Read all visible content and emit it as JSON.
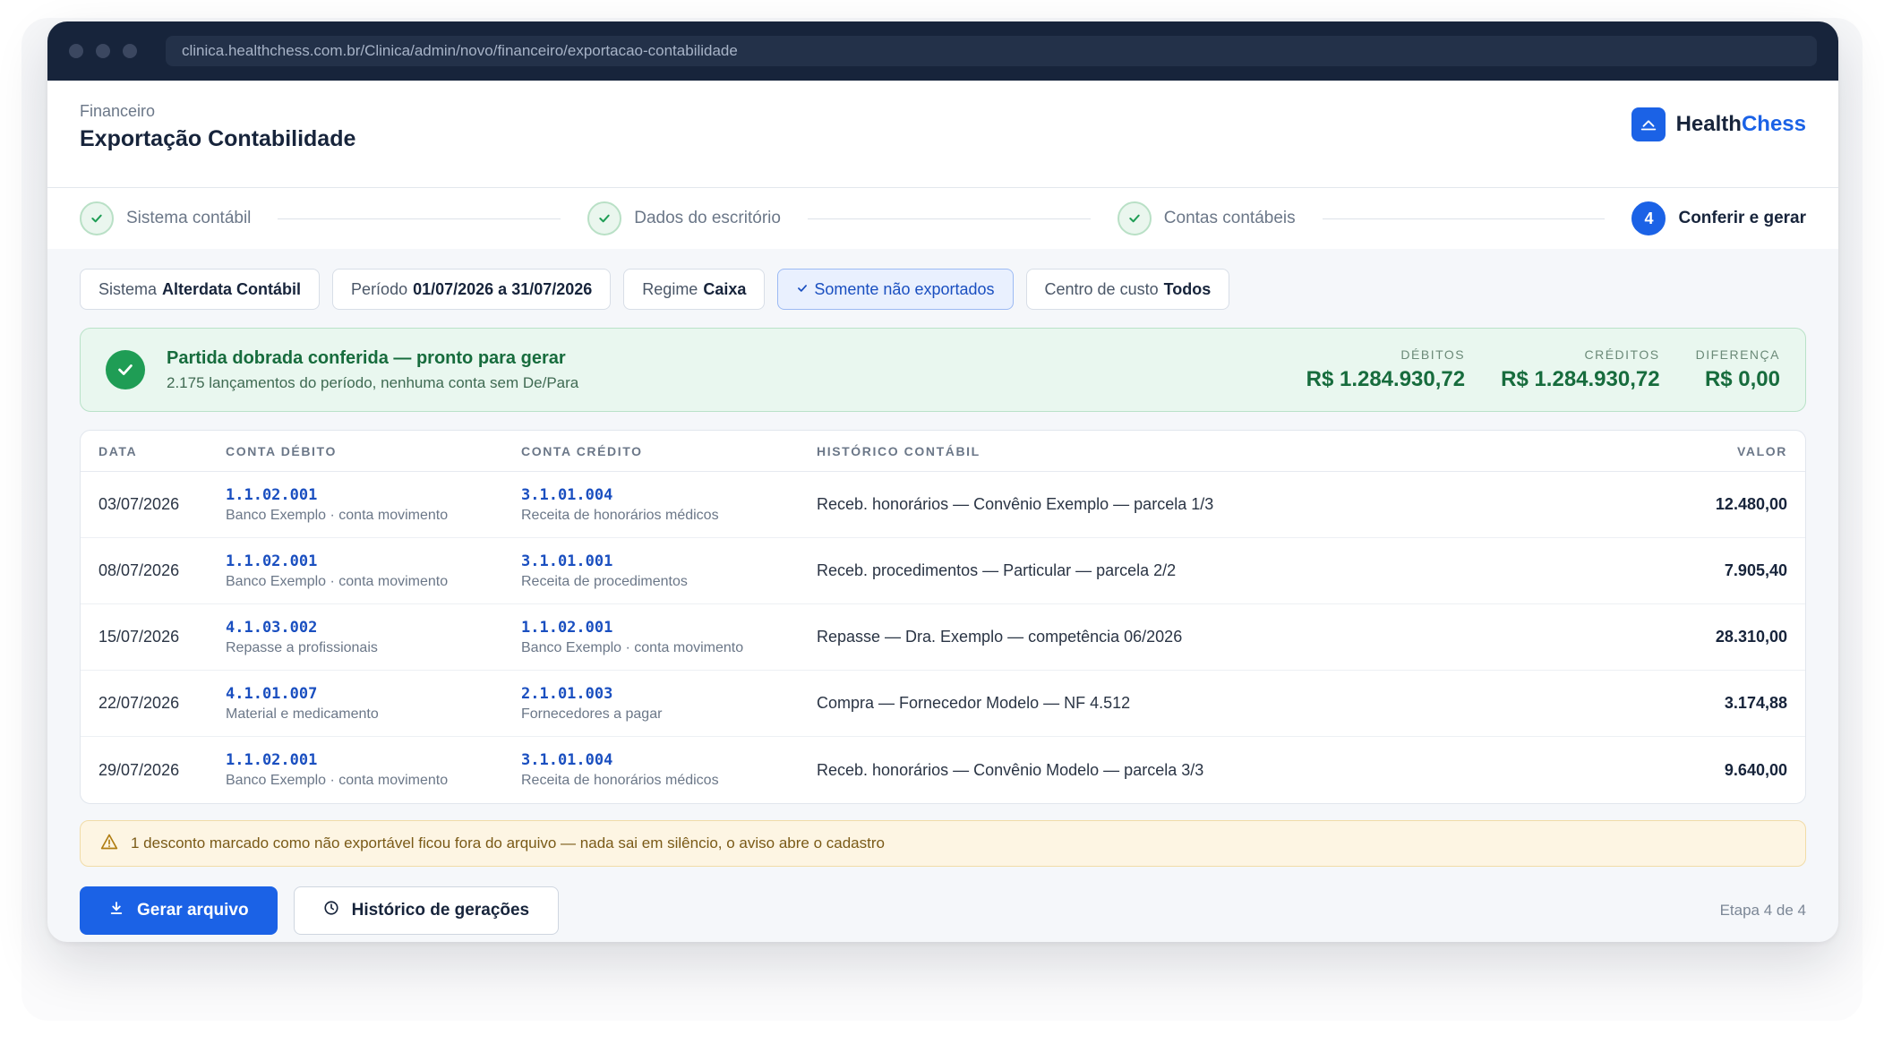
{
  "browser": {
    "url": "clinica.healthchess.com.br/Clinica/admin/novo/financeiro/exportacao-contabilidade"
  },
  "header": {
    "breadcrumb": "Financeiro",
    "title": "Exportação Contabilidade",
    "brand_primary": "Health",
    "brand_accent": "Chess"
  },
  "stepper": {
    "steps": [
      {
        "label": "Sistema contábil",
        "status": "done"
      },
      {
        "label": "Dados do escritório",
        "status": "done"
      },
      {
        "label": "Contas contábeis",
        "status": "done"
      },
      {
        "label": "Conferir e gerar",
        "status": "active",
        "number": "4"
      }
    ]
  },
  "filters": {
    "sistema": {
      "label": "Sistema",
      "value": "Alterdata Contábil"
    },
    "periodo": {
      "label": "Período",
      "value": "01/07/2026 a 31/07/2026"
    },
    "regime": {
      "label": "Regime",
      "value": "Caixa"
    },
    "somente": {
      "label": "Somente não exportados"
    },
    "centro": {
      "label": "Centro de custo",
      "value": "Todos"
    }
  },
  "summary": {
    "title": "Partida dobrada conferida — pronto para gerar",
    "subtitle": "2.175 lançamentos do período, nenhuma conta sem De/Para",
    "debitos_label": "DÉBITOS",
    "debitos_value": "R$ 1.284.930,72",
    "creditos_label": "CRÉDITOS",
    "creditos_value": "R$ 1.284.930,72",
    "diferenca_label": "DIFERENÇA",
    "diferenca_value": "R$ 0,00"
  },
  "table": {
    "headers": {
      "date": "DATA",
      "debit": "CONTA DÉBITO",
      "credit": "CONTA CRÉDITO",
      "history": "HISTÓRICO CONTÁBIL",
      "value": "VALOR"
    },
    "rows": [
      {
        "date": "03/07/2026",
        "debit_code": "1.1.02.001",
        "debit_name": "Banco Exemplo · conta movimento",
        "credit_code": "3.1.01.004",
        "credit_name": "Receita de honorários médicos",
        "history": "Receb. honorários — Convênio Exemplo — parcela 1/3",
        "value": "12.480,00"
      },
      {
        "date": "08/07/2026",
        "debit_code": "1.1.02.001",
        "debit_name": "Banco Exemplo · conta movimento",
        "credit_code": "3.1.01.001",
        "credit_name": "Receita de procedimentos",
        "history": "Receb. procedimentos — Particular — parcela 2/2",
        "value": "7.905,40"
      },
      {
        "date": "15/07/2026",
        "debit_code": "4.1.03.002",
        "debit_name": "Repasse a profissionais",
        "credit_code": "1.1.02.001",
        "credit_name": "Banco Exemplo · conta movimento",
        "history": "Repasse — Dra. Exemplo — competência 06/2026",
        "value": "28.310,00"
      },
      {
        "date": "22/07/2026",
        "debit_code": "4.1.01.007",
        "debit_name": "Material e medicamento",
        "credit_code": "2.1.01.003",
        "credit_name": "Fornecedores a pagar",
        "history": "Compra — Fornecedor Modelo — NF 4.512",
        "value": "3.174,88"
      },
      {
        "date": "29/07/2026",
        "debit_code": "1.1.02.001",
        "debit_name": "Banco Exemplo · conta movimento",
        "credit_code": "3.1.01.004",
        "credit_name": "Receita de honorários médicos",
        "history": "Receb. honorários — Convênio Modelo — parcela 3/3",
        "value": "9.640,00"
      }
    ]
  },
  "warning": {
    "text": "1 desconto marcado como não exportável ficou fora do arquivo — nada sai em silêncio, o aviso abre o cadastro"
  },
  "actions": {
    "generate": "Gerar arquivo",
    "history": "Histórico de gerações",
    "step_counter": "Etapa 4 de 4"
  },
  "colors": {
    "primary": "#1b62e6",
    "success": "#1f9d55",
    "navy": "#17243b",
    "warning_bg": "#fdf5e3"
  },
  "icons": [
    "check-icon",
    "download-icon",
    "clock-icon",
    "warning-icon",
    "home-icon"
  ]
}
